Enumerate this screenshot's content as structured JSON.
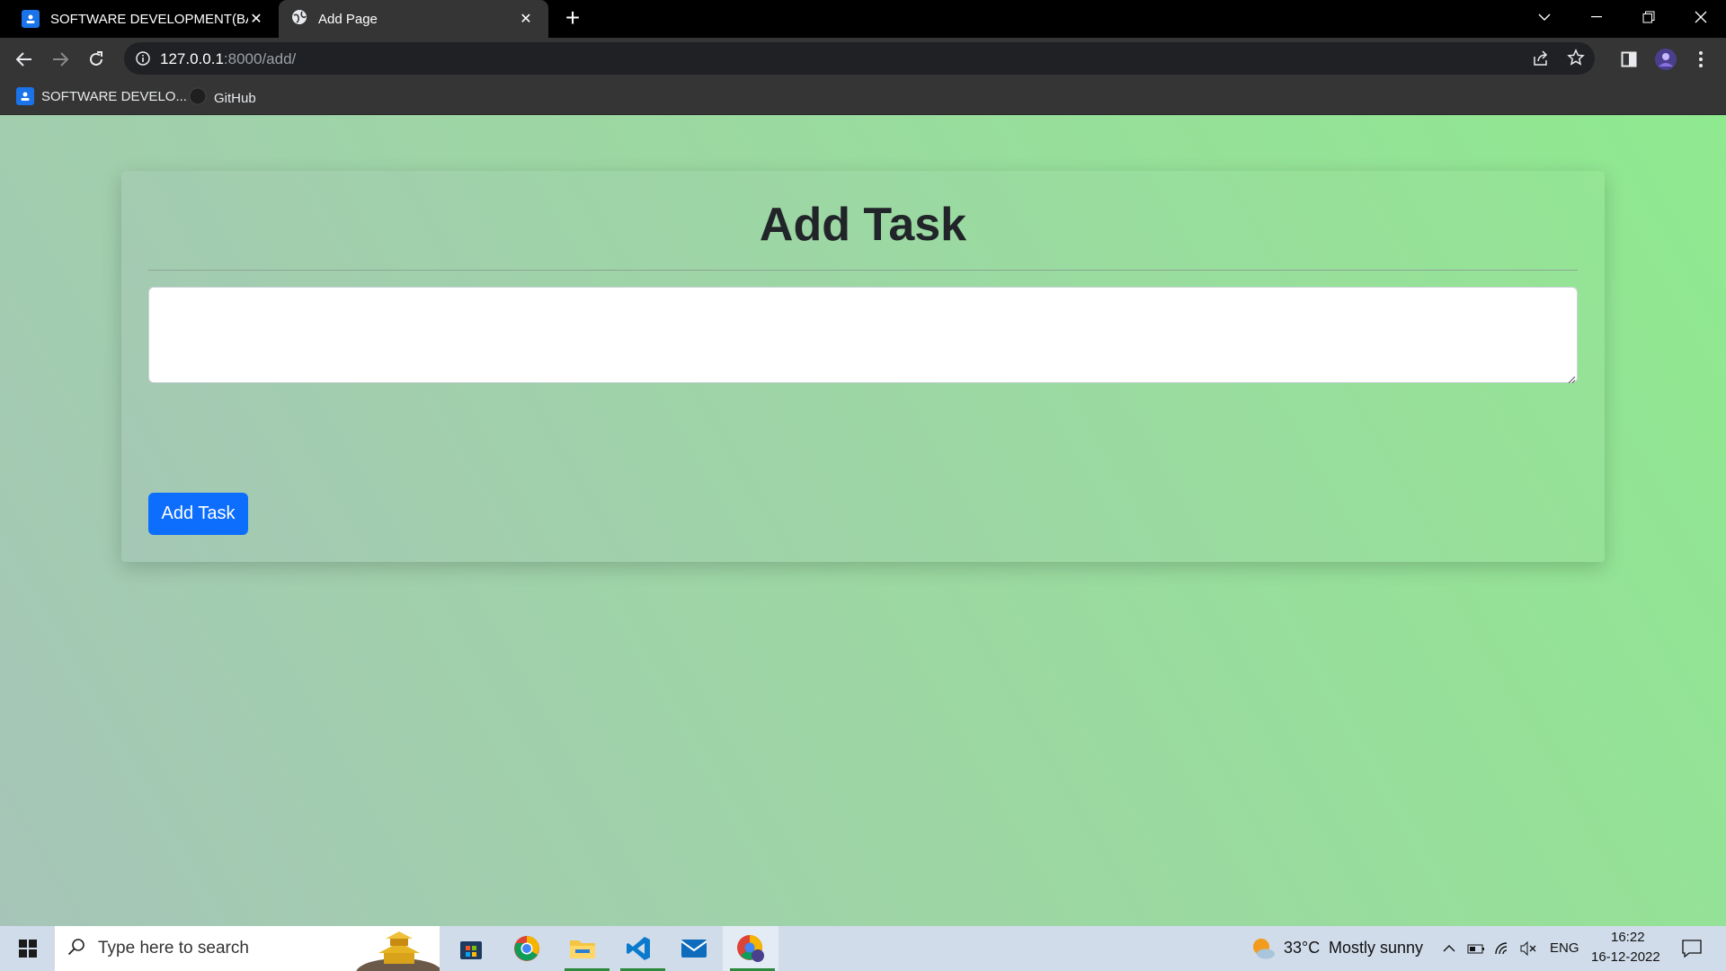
{
  "browser": {
    "tabs": [
      {
        "title": "SOFTWARE DEVELOPMENT(BATC",
        "icon": "classroom-icon",
        "active": false
      },
      {
        "title": "Add Page",
        "icon": "globe-icon",
        "active": true
      }
    ],
    "url_host": "127.0.0.1",
    "url_path": ":8000/add/",
    "bookmarks": [
      {
        "label": "SOFTWARE DEVELO...",
        "icon": "classroom-icon"
      },
      {
        "label": "GitHub",
        "icon": "github-icon"
      }
    ]
  },
  "page": {
    "title": "Add Task",
    "task_input_value": "",
    "task_input_placeholder": "",
    "submit_label": "Add Task",
    "button_color": "#0d6efd"
  },
  "taskbar": {
    "search_placeholder": "Type here to search",
    "apps": [
      "store-icon",
      "chrome-icon",
      "file-explorer-icon",
      "vscode-icon",
      "mail-icon",
      "chrome-profile-icon"
    ],
    "weather_temp": "33°C",
    "weather_desc": "Mostly sunny",
    "language": "ENG",
    "time": "16:22",
    "date": "16-12-2022"
  }
}
